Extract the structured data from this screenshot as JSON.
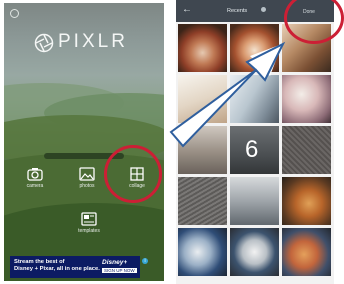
{
  "left_app": {
    "logo_text": "PIXLR",
    "tools": [
      {
        "label": "camera",
        "icon": "camera-icon"
      },
      {
        "label": "photos",
        "icon": "photos-icon"
      },
      {
        "label": "collage",
        "icon": "collage-icon"
      },
      {
        "label": "templates",
        "icon": "templates-icon"
      }
    ],
    "ad": {
      "line1": "Stream the best of",
      "line2": "Disney + Pixar, all in one place.",
      "brand": "Disney+",
      "cta": "SIGN UP NOW"
    },
    "colors": {
      "ad_background": "#0c1b63",
      "highlight_ring": "#cc1f35"
    }
  },
  "right_app": {
    "header_title": "Recents",
    "done_label": "Done",
    "highlighted_cell_number": "6",
    "colors": {
      "header": "#3f4750"
    }
  },
  "overlay": {
    "arrow": "white-outline-arrow-icon",
    "highlight_rings": [
      "collage-button",
      "done-button"
    ]
  }
}
